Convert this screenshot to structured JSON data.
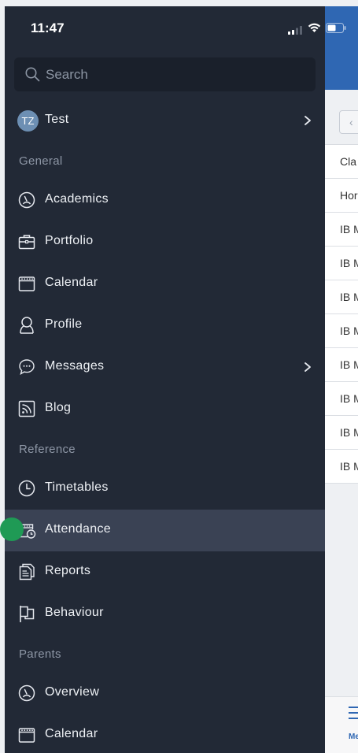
{
  "status": {
    "time": "11:47"
  },
  "search": {
    "placeholder": "Search"
  },
  "user": {
    "initials": "TZ",
    "name": "Test"
  },
  "sections": {
    "general": "General",
    "reference": "Reference",
    "parents": "Parents"
  },
  "menu": {
    "academics": "Academics",
    "portfolio": "Portfolio",
    "calendar": "Calendar",
    "profile": "Profile",
    "messages": "Messages",
    "blog": "Blog",
    "timetables": "Timetables",
    "attendance": "Attendance",
    "reports": "Reports",
    "behaviour": "Behaviour",
    "overview": "Overview",
    "parents_calendar": "Calendar"
  },
  "background": {
    "rows": [
      "Cla",
      "Hor",
      "IB M",
      "IB M",
      "IB M",
      "IB M",
      "IB M",
      "IB M",
      "IB M",
      "IB M"
    ],
    "tab_label": "Me"
  },
  "colors": {
    "drawer_bg": "#222936",
    "active_row": "#3a4254",
    "accent": "#2f67b3",
    "touch": "#1f9a55"
  }
}
